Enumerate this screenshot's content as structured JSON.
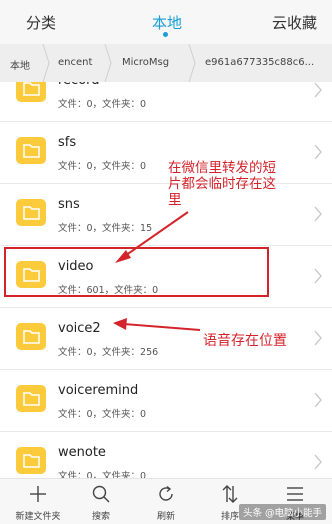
{
  "tabs": [
    {
      "label": "分类",
      "active": false
    },
    {
      "label": "本地",
      "active": true
    },
    {
      "label": "云收藏",
      "active": false
    }
  ],
  "accent_color": "#1b9fd4",
  "breadcrumb": [
    "本地",
    "encent",
    "MicroMsg",
    "e961a677335c88c6..."
  ],
  "items": [
    {
      "name": "record",
      "meta": "文件：0，文件夹：0"
    },
    {
      "name": "sfs",
      "meta": "文件：0，文件夹：0"
    },
    {
      "name": "sns",
      "meta": "文件：0，文件夹：15"
    },
    {
      "name": "video",
      "meta": "文件：601，文件夹：0"
    },
    {
      "name": "voice2",
      "meta": "文件：0，文件夹：256"
    },
    {
      "name": "voiceremind",
      "meta": "文件：0，文件夹：0"
    },
    {
      "name": "wenote",
      "meta": "文件：0，文件夹：0"
    }
  ],
  "annotations": {
    "video_note": "在微信里转发的短片都会临时存在这里",
    "voice_note": "语音存在位置",
    "color": "#d4242b"
  },
  "toolbar": [
    {
      "label": "新建文件夹",
      "icon": "plus-icon"
    },
    {
      "label": "搜索",
      "icon": "search-icon"
    },
    {
      "label": "刷新",
      "icon": "refresh-icon"
    },
    {
      "label": "排序",
      "icon": "sort-icon"
    },
    {
      "label": "菜单",
      "icon": "menu-icon"
    }
  ],
  "watermark": "头条 @电脑小能手"
}
